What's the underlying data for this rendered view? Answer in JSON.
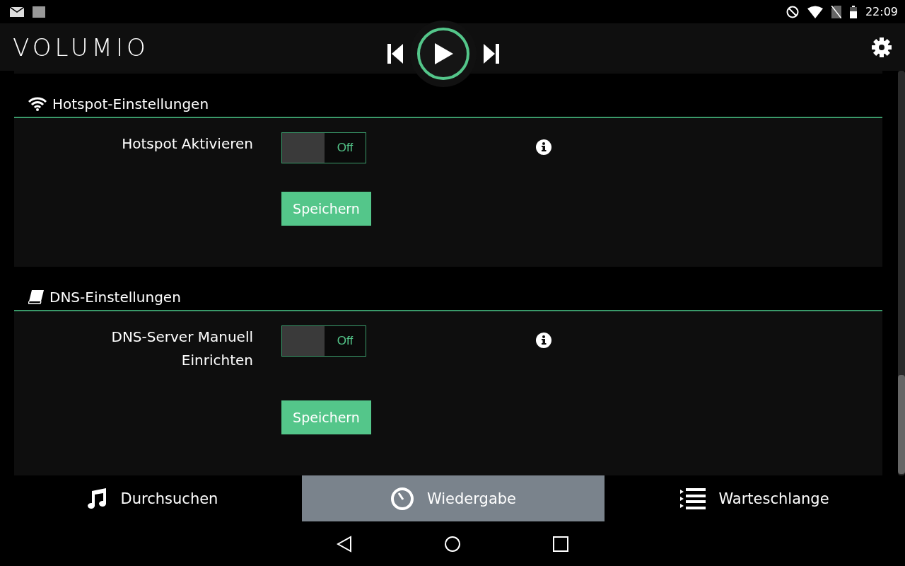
{
  "status_bar": {
    "time": "22:09"
  },
  "header": {
    "logo": "VOLUMIO"
  },
  "sections": [
    {
      "kind": "wifi",
      "title": "Hotspot-Einstellungen",
      "rows": [
        {
          "label": "Hotspot Aktivieren",
          "toggle": {
            "on": false,
            "text": "Off"
          }
        }
      ],
      "save": "Speichern"
    },
    {
      "kind": "book",
      "title": "DNS-Einstellungen",
      "rows": [
        {
          "label": "DNS-Server Manuell Einrichten",
          "toggle": {
            "on": false,
            "text": "Off"
          }
        }
      ],
      "save": "Speichern"
    }
  ],
  "tabs": [
    {
      "kind": "music",
      "label": "Durchsuchen",
      "selected": false
    },
    {
      "kind": "dial",
      "label": "Wiedergabe",
      "selected": true
    },
    {
      "kind": "list",
      "label": "Warteschlange",
      "selected": false
    }
  ]
}
